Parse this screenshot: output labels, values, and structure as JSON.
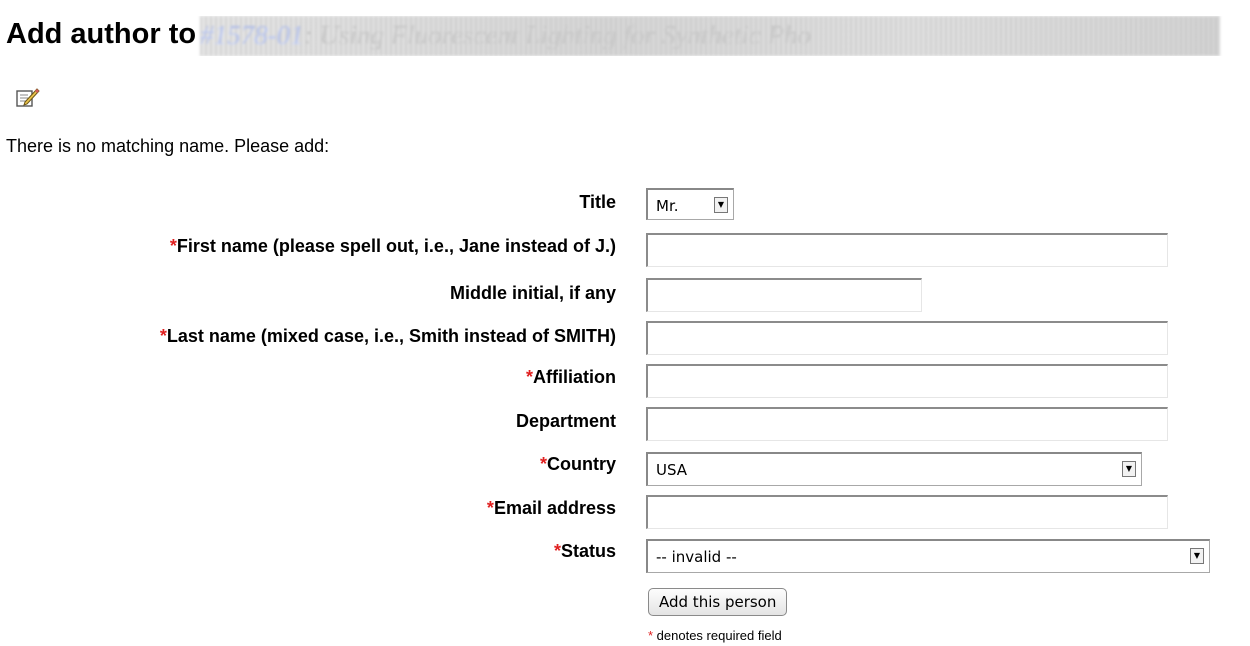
{
  "heading": {
    "prefix": "Add author to",
    "paper_number": "#1578-01",
    "paper_title": ": Using Fluorescent Lighting for Synthetic Pho"
  },
  "intro": "There is no matching name. Please add:",
  "form": {
    "title": {
      "label": "Title",
      "value": "Mr."
    },
    "first_name": {
      "required": "*",
      "label": "First name (please spell out, i.e., Jane instead of J.)",
      "value": ""
    },
    "middle_initial": {
      "label": "Middle initial, if any",
      "value": ""
    },
    "last_name": {
      "required": "*",
      "label": "Last name (mixed case, i.e., Smith instead of SMITH)",
      "value": ""
    },
    "affiliation": {
      "required": "*",
      "label": "Affiliation",
      "value": ""
    },
    "department": {
      "label": "Department",
      "value": ""
    },
    "country": {
      "required": "*",
      "label": "Country",
      "value": "USA"
    },
    "email": {
      "required": "*",
      "label": "Email address",
      "value": ""
    },
    "status": {
      "required": "*",
      "label": "Status",
      "value": "-- invalid --"
    },
    "submit_label": "Add this person"
  },
  "footnote": {
    "marker": "*",
    "text": " denotes required field"
  },
  "icons": {
    "edit": "edit-note-icon",
    "dropdown": "chevron-down-icon"
  },
  "colors": {
    "required": "#e02020"
  }
}
